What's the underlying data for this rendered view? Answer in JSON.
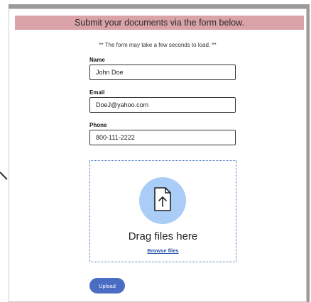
{
  "banner": {
    "title": "Submit your documents via the form below."
  },
  "notice": "** The form may take a few seconds to load. **",
  "form": {
    "name_label": "Name",
    "name_value": "John Doe",
    "email_label": "Email",
    "email_value": "DoeJ@yahoo.com",
    "phone_label": "Phone",
    "phone_value": "800-111-2222"
  },
  "dropzone": {
    "icon": "upload-file-icon",
    "drag_text": "Drag files here",
    "browse_label": "Browse files"
  },
  "actions": {
    "upload_label": "Upload"
  },
  "colors": {
    "banner_bg": "#d9a3a8",
    "accent_blue": "#4a6cc3",
    "icon_circle": "#a9cdf7",
    "dropzone_border": "#3d6fb6"
  }
}
